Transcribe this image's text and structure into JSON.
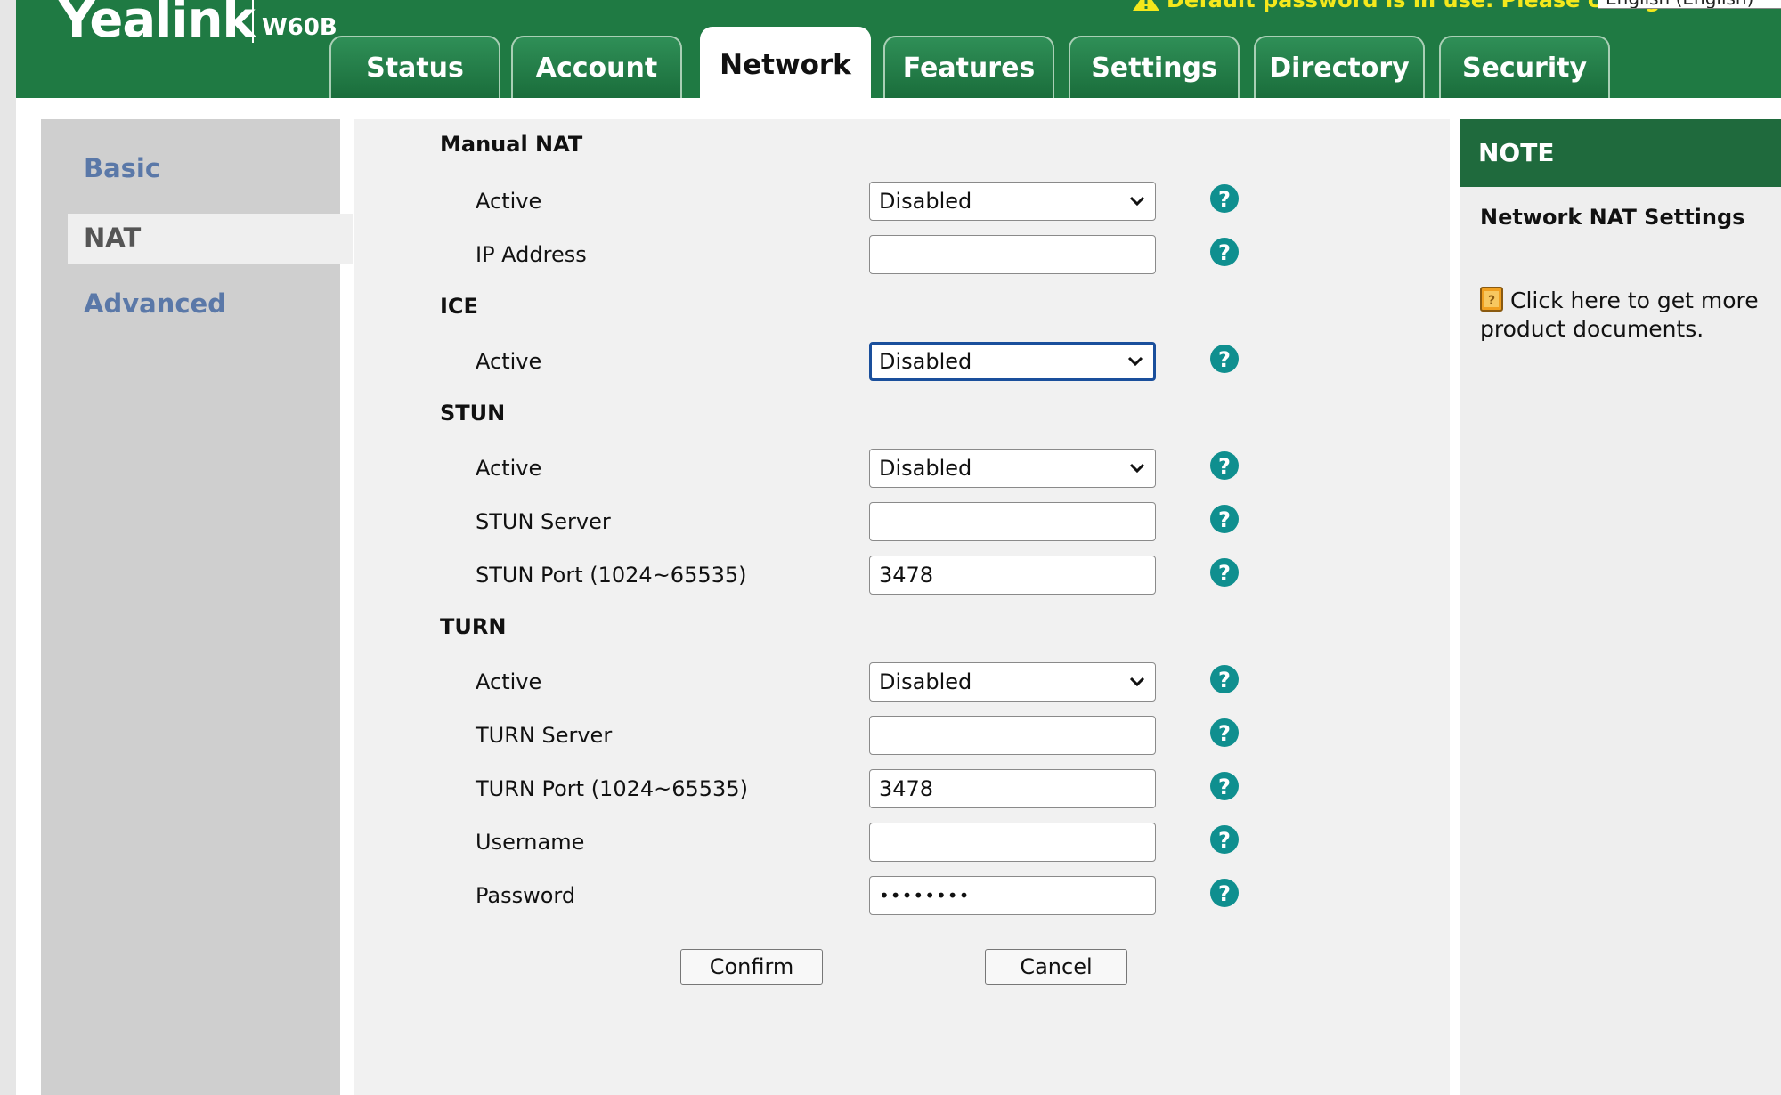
{
  "header": {
    "brand": "Yealink",
    "model": "W60B",
    "warning": "Default password is in use. Please change!",
    "language": "English (English)"
  },
  "tabs": [
    {
      "label": "Status"
    },
    {
      "label": "Account"
    },
    {
      "label": "Network",
      "active": true
    },
    {
      "label": "Features"
    },
    {
      "label": "Settings"
    },
    {
      "label": "Directory"
    },
    {
      "label": "Security"
    }
  ],
  "sidebar": {
    "items": [
      {
        "label": "Basic"
      },
      {
        "label": "NAT",
        "active": true
      },
      {
        "label": "Advanced"
      }
    ]
  },
  "form": {
    "manual_nat": {
      "title": "Manual NAT",
      "active_label": "Active",
      "active_value": "Disabled",
      "ip_label": "IP Address",
      "ip_value": ""
    },
    "ice": {
      "title": "ICE",
      "active_label": "Active",
      "active_value": "Disabled"
    },
    "stun": {
      "title": "STUN",
      "active_label": "Active",
      "active_value": "Disabled",
      "server_label": "STUN Server",
      "server_value": "",
      "port_label": "STUN Port (1024~65535)",
      "port_value": "3478"
    },
    "turn": {
      "title": "TURN",
      "active_label": "Active",
      "active_value": "Disabled",
      "server_label": "TURN Server",
      "server_value": "",
      "port_label": "TURN Port (1024~65535)",
      "port_value": "3478",
      "username_label": "Username",
      "username_value": "",
      "password_label": "Password",
      "password_value": "••••••••"
    },
    "confirm_label": "Confirm",
    "cancel_label": "Cancel"
  },
  "note": {
    "heading": "NOTE",
    "title": "Network NAT Settings",
    "link": "Click here to get more product documents."
  },
  "colors": {
    "header_green": "#1f7a43",
    "help_teal": "#0f8f8f",
    "sidebar_link": "#5a78a8",
    "warning_yellow": "#f4e81c"
  }
}
